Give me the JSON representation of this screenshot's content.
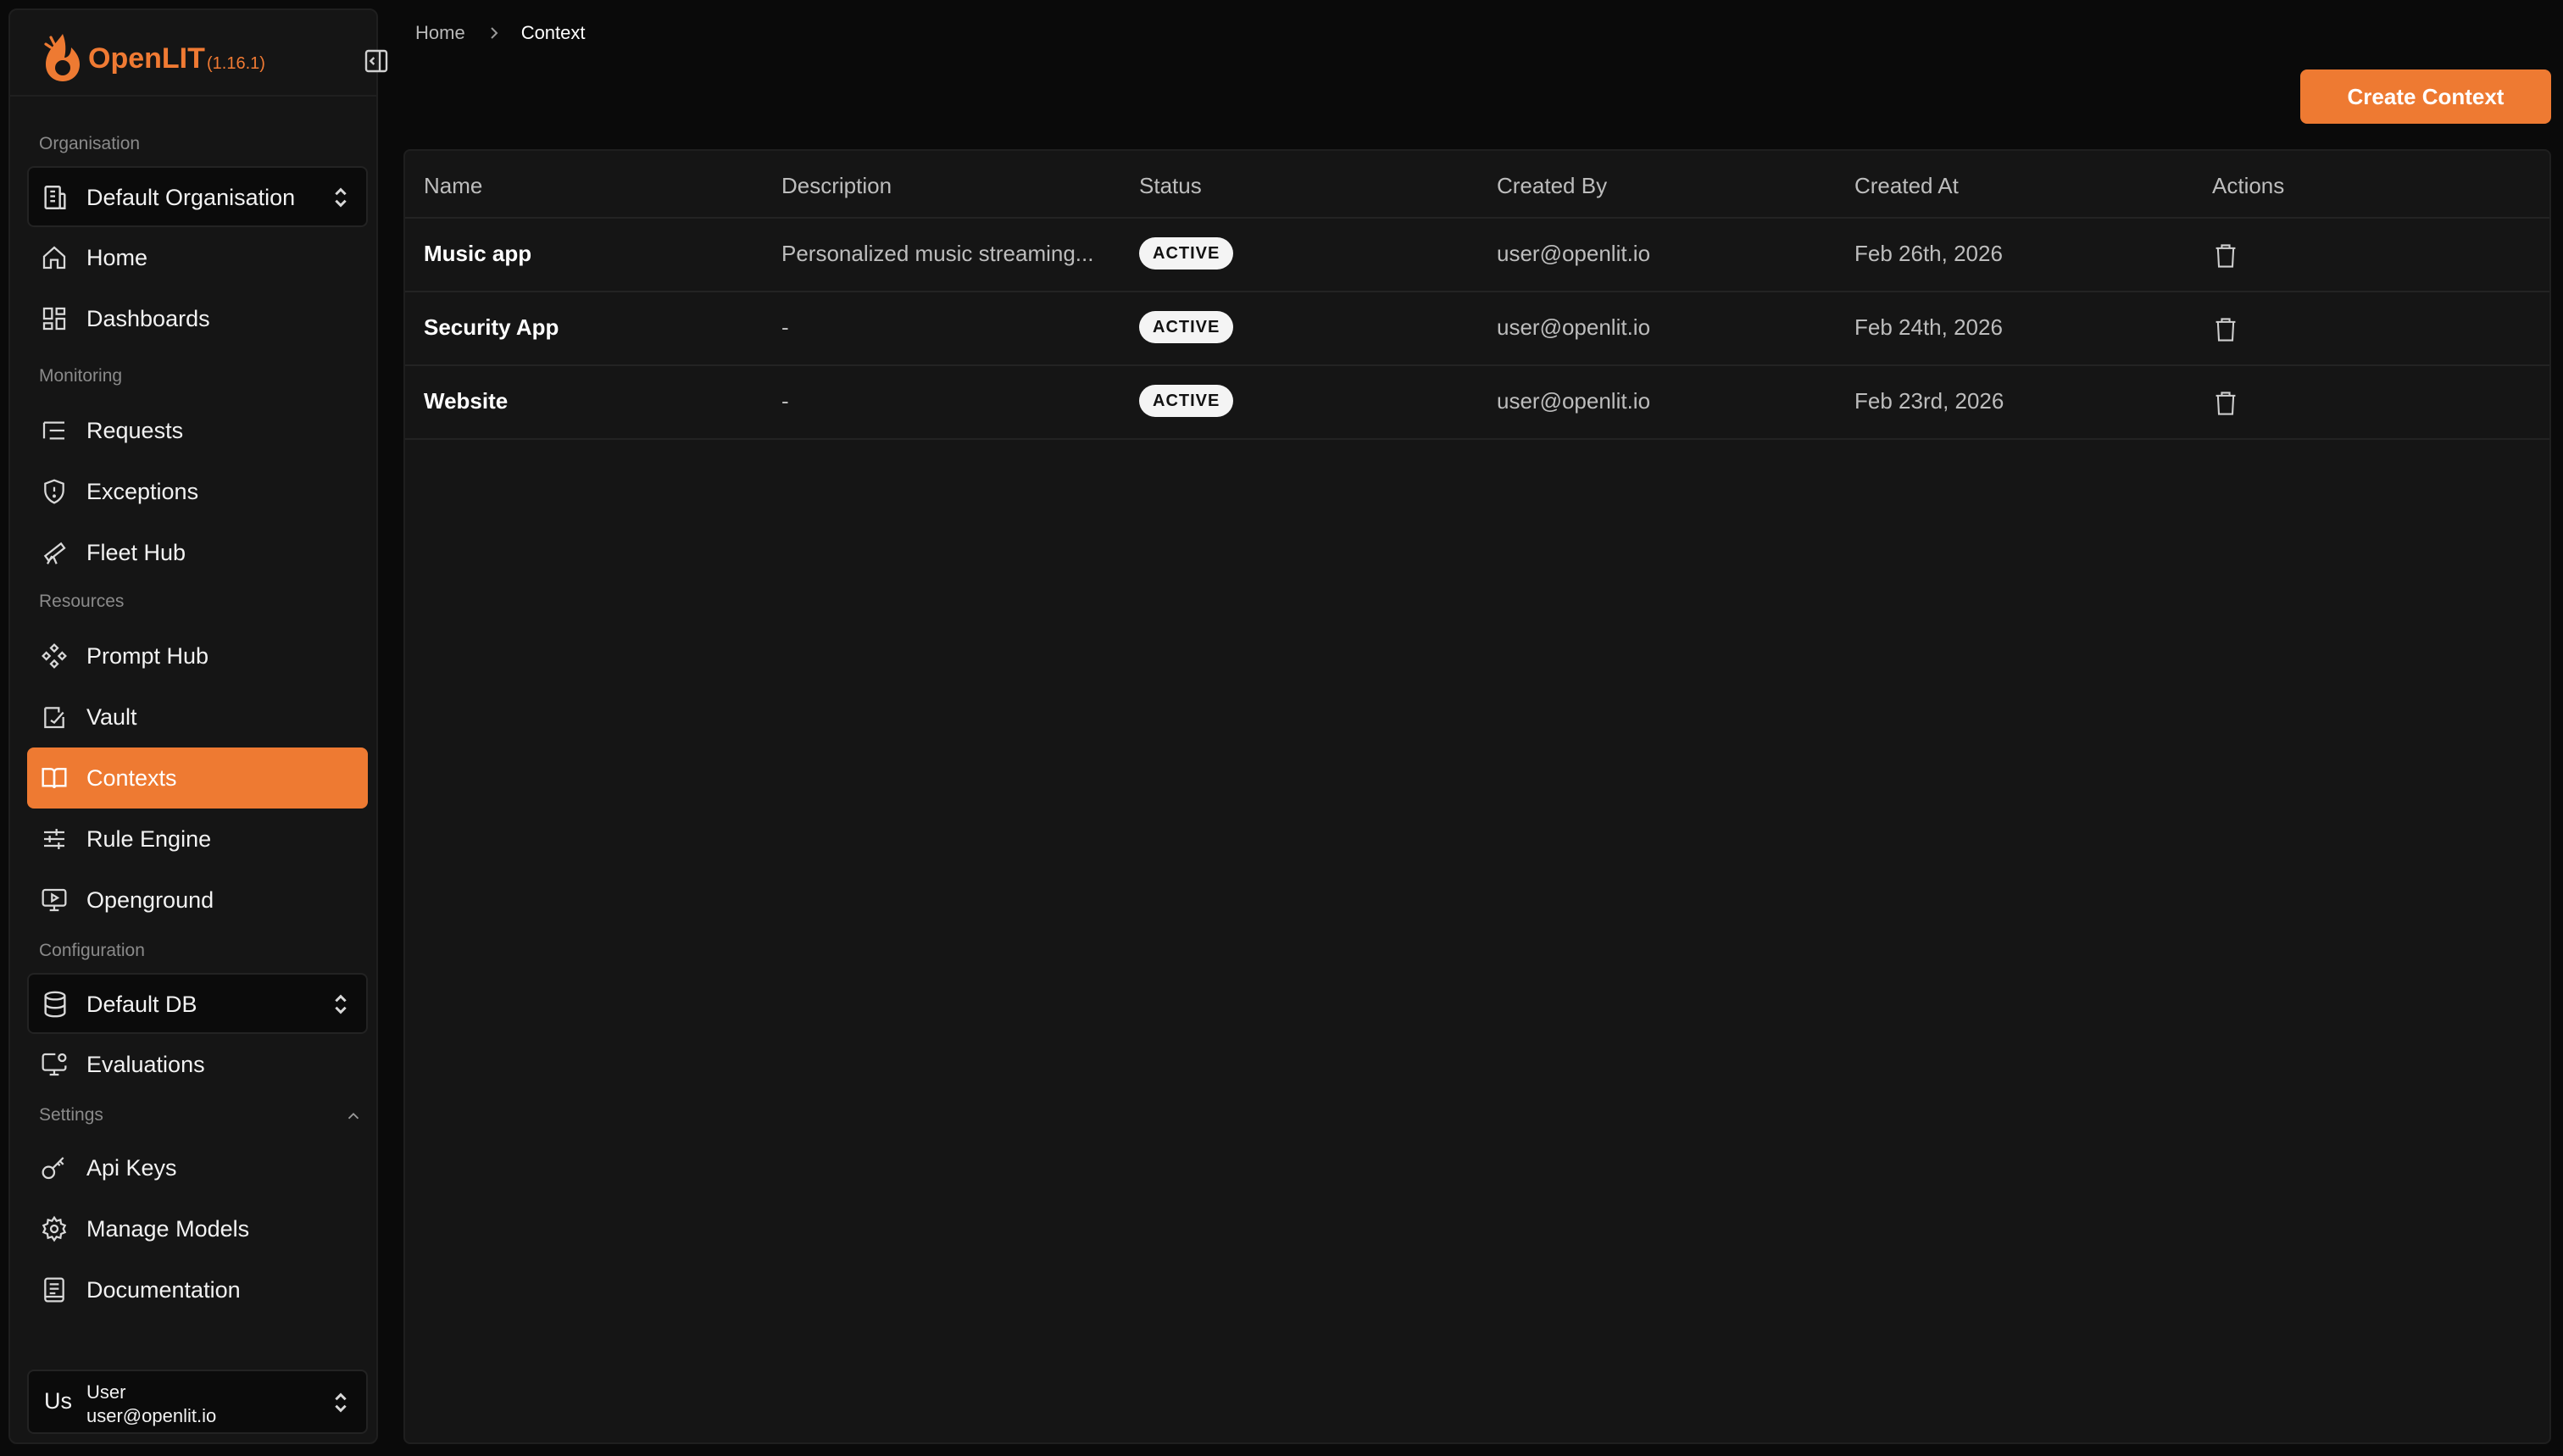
{
  "app": {
    "name": "OpenLIT",
    "version": "(1.16.1)"
  },
  "sidebar": {
    "sections": {
      "organisation": "Organisation",
      "monitoring": "Monitoring",
      "resources": "Resources",
      "configuration": "Configuration",
      "settings": "Settings"
    },
    "org_select": "Default Organisation",
    "db_select": "Default DB",
    "items": {
      "home": "Home",
      "dashboards": "Dashboards",
      "requests": "Requests",
      "exceptions": "Exceptions",
      "fleet_hub": "Fleet Hub",
      "prompt_hub": "Prompt Hub",
      "vault": "Vault",
      "contexts": "Contexts",
      "rule_engine": "Rule Engine",
      "openground": "Openground",
      "evaluations": "Evaluations",
      "api_keys": "Api Keys",
      "manage_models": "Manage Models",
      "documentation": "Documentation"
    },
    "active_item": "Contexts",
    "user": {
      "avatar": "Us",
      "name": "User",
      "email": "user@openlit.io"
    }
  },
  "breadcrumb": {
    "home": "Home",
    "current": "Context"
  },
  "create_button": "Create Context",
  "table": {
    "headers": {
      "name": "Name",
      "description": "Description",
      "status": "Status",
      "created_by": "Created By",
      "created_at": "Created At",
      "actions": "Actions"
    },
    "rows": [
      {
        "name": "Music app",
        "description": "Personalized music streaming...",
        "status": "ACTIVE",
        "created_by": "user@openlit.io",
        "created_at": "Feb 26th, 2026"
      },
      {
        "name": "Security App",
        "description": "-",
        "status": "ACTIVE",
        "created_by": "user@openlit.io",
        "created_at": "Feb 24th, 2026"
      },
      {
        "name": "Website",
        "description": "-",
        "status": "ACTIVE",
        "created_by": "user@openlit.io",
        "created_at": "Feb 23rd, 2026"
      }
    ]
  },
  "colors": {
    "accent": "#ee7a32",
    "background": "#0a0a0a",
    "panel": "#151515"
  }
}
